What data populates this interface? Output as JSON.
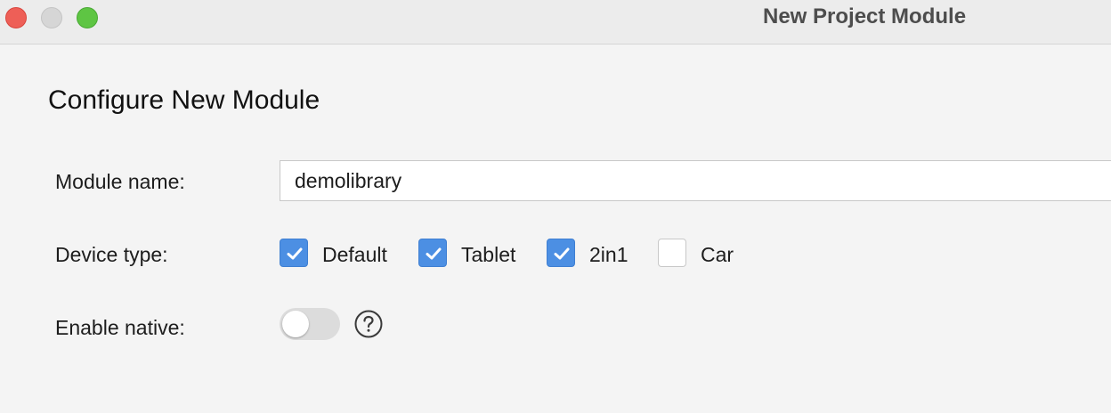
{
  "window": {
    "title": "New Project Module",
    "controls": [
      "close",
      "minimize",
      "maximize"
    ]
  },
  "form": {
    "heading": "Configure New Module",
    "module_name": {
      "label": "Module name:",
      "value": "demolibrary"
    },
    "device_type": {
      "label": "Device type:",
      "options": [
        {
          "label": "Default",
          "checked": true
        },
        {
          "label": "Tablet",
          "checked": true
        },
        {
          "label": "2in1",
          "checked": true
        },
        {
          "label": "Car",
          "checked": false
        }
      ]
    },
    "enable_native": {
      "label": "Enable native:",
      "enabled": false,
      "help_icon": "question-circle-icon"
    }
  },
  "colors": {
    "checkbox_checked": "#4c8fe3",
    "close": "#ee5f57",
    "maximize": "#5ec543"
  }
}
